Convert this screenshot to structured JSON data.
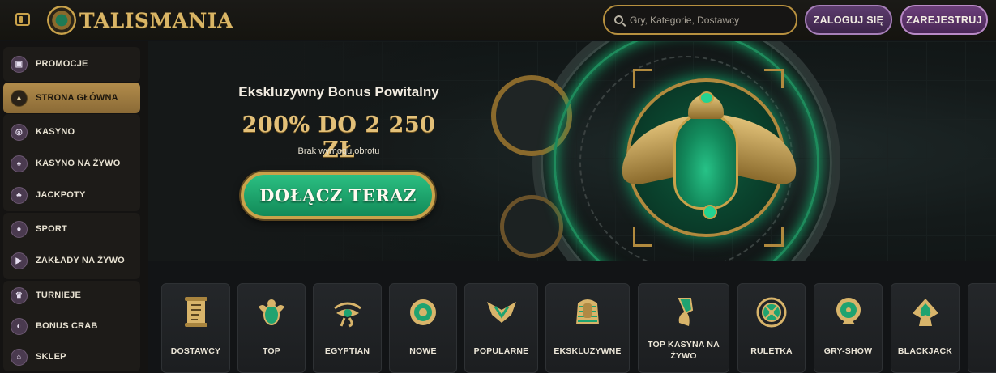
{
  "header": {
    "logo_text": "TALISMANIA",
    "search_placeholder": "Gry, Kategorie, Dostawcy",
    "login_label": "ZALOGUJ SIĘ",
    "register_label": "ZAREJESTRUJ"
  },
  "sidebar": {
    "items": [
      {
        "label": "PROMOCJE",
        "icon": "gift-icon",
        "active": false
      },
      {
        "label": "STRONA GŁÓWNA",
        "icon": "home-icon",
        "active": true
      },
      {
        "label": "KASYNO",
        "icon": "casino-chip-icon",
        "active": false
      },
      {
        "label": "KASYNO NA ŻYWO",
        "icon": "spade-icon",
        "active": false
      },
      {
        "label": "JACKPOTY",
        "icon": "clover-icon",
        "active": false
      },
      {
        "label": "SPORT",
        "icon": "soccer-ball-icon",
        "active": false
      },
      {
        "label": "ZAKŁADY NA ŻYWO",
        "icon": "play-icon",
        "active": false
      },
      {
        "label": "TURNIEJE",
        "icon": "trophy-icon",
        "active": false
      },
      {
        "label": "BONUS CRAB",
        "icon": "crab-icon",
        "active": false
      },
      {
        "label": "SKLEP",
        "icon": "shop-icon",
        "active": false
      }
    ]
  },
  "banner": {
    "subtitle": "Ekskluzywny Bonus Powitalny",
    "amount": "200% DO 2 250 ZŁ",
    "note": "Brak wymogu obrotu",
    "cta_label": "DOŁĄCZ TERAZ"
  },
  "categories": [
    {
      "label": "DOSTAWCY",
      "icon": "scroll-icon"
    },
    {
      "label": "TOP",
      "icon": "scarab-icon"
    },
    {
      "label": "EGYPTIAN",
      "icon": "eye-of-horus-icon"
    },
    {
      "label": "NOWE",
      "icon": "sun-disc-icon"
    },
    {
      "label": "POPULARNE",
      "icon": "winged-crest-icon"
    },
    {
      "label": "EKSKLUZYWNE",
      "icon": "pharaoh-mask-icon"
    },
    {
      "label": "TOP KASYNA NA ŻYWO",
      "icon": "nefertiti-icon"
    },
    {
      "label": "RULETKA",
      "icon": "roulette-icon"
    },
    {
      "label": "GRY-SHOW",
      "icon": "wheel-icon"
    },
    {
      "label": "BLACKJACK",
      "icon": "spade-card-icon"
    }
  ],
  "colors": {
    "gold": "#c9a24a",
    "emerald": "#1e9e68",
    "purple": "#5c3c6e",
    "background": "#121416"
  }
}
